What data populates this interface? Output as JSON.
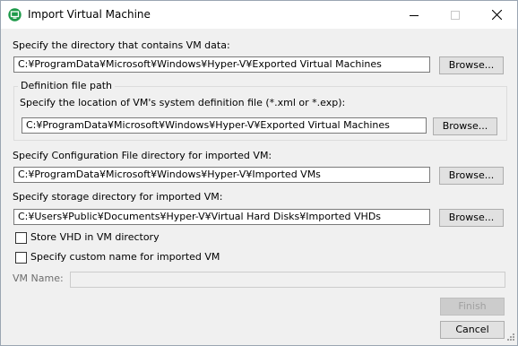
{
  "window": {
    "title": "Import Virtual Machine",
    "app_icon": "hyperv-app-icon"
  },
  "vm_data": {
    "label": "Specify the directory that contains VM data:",
    "value": "C:¥ProgramData¥Microsoft¥Windows¥Hyper-V¥Exported Virtual Machines",
    "browse_label": "Browse..."
  },
  "definition_group": {
    "title": "Definition file path",
    "label": "Specify the location of VM's system definition file (*.xml or *.exp):",
    "value": "C:¥ProgramData¥Microsoft¥Windows¥Hyper-V¥Exported Virtual Machines",
    "browse_label": "Browse..."
  },
  "config_dir": {
    "label": "Specify Configuration File directory for imported VM:",
    "value": "C:¥ProgramData¥Microsoft¥Windows¥Hyper-V¥Imported VMs",
    "browse_label": "Browse..."
  },
  "storage_dir": {
    "label": "Specify storage directory for imported VM:",
    "value": "C:¥Users¥Public¥Documents¥Hyper-V¥Virtual Hard Disks¥Imported VHDs",
    "browse_label": "Browse..."
  },
  "options": {
    "store_vhd_label": "Store VHD in VM directory",
    "store_vhd_checked": false,
    "custom_name_label": "Specify custom name for imported VM",
    "custom_name_checked": false
  },
  "vm_name": {
    "label": "VM Name:",
    "value": ""
  },
  "buttons": {
    "finish": "Finish",
    "cancel": "Cancel"
  }
}
